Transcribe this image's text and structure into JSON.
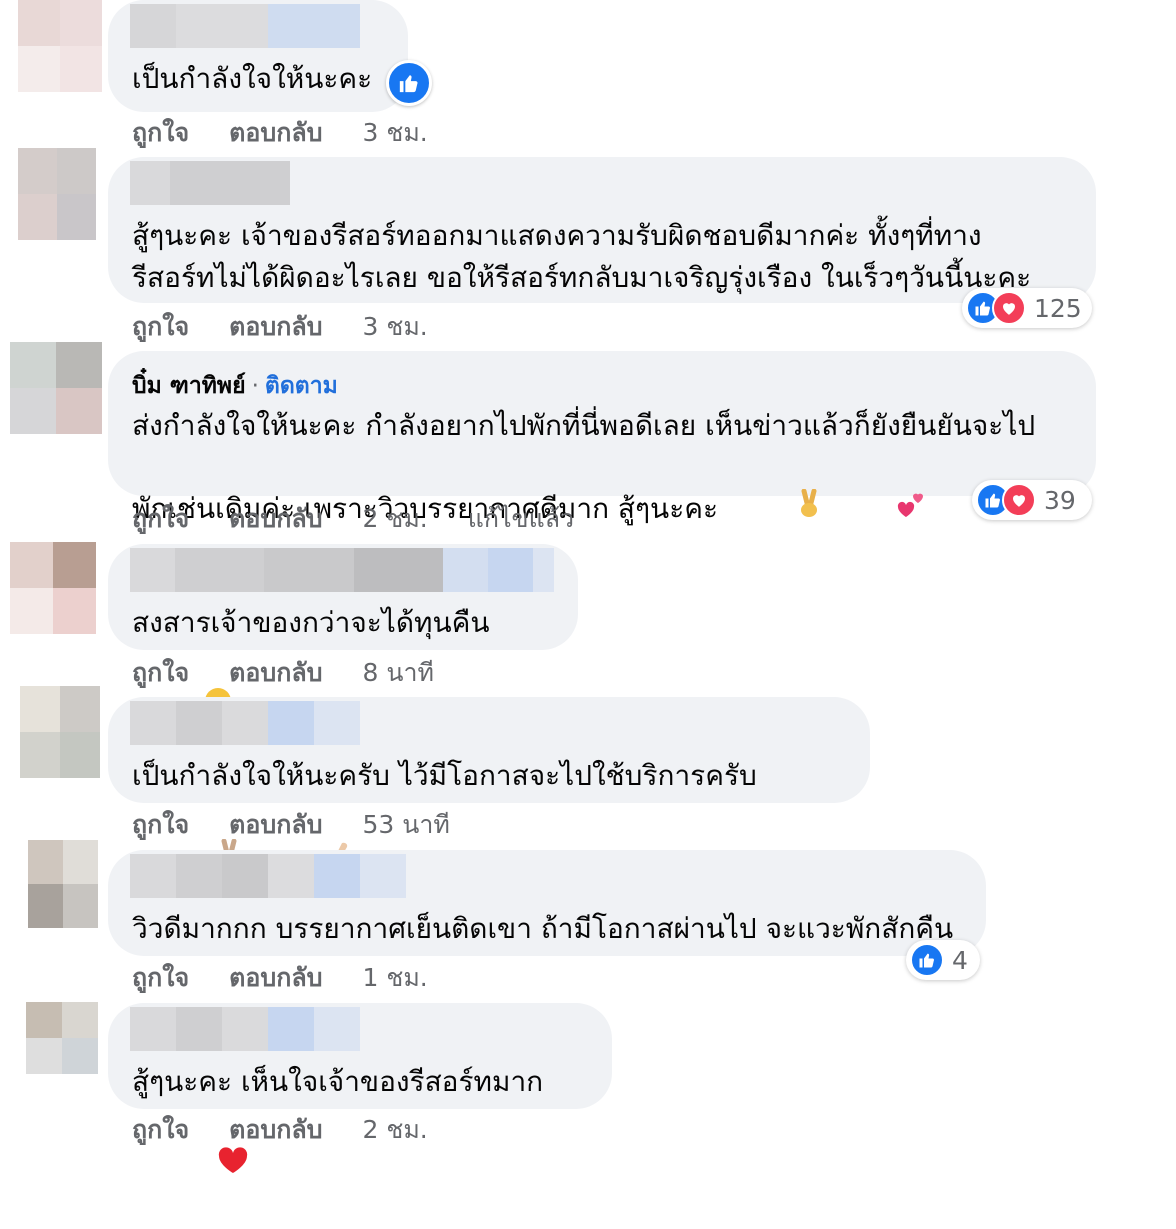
{
  "actions": {
    "like": "ถูกใจ",
    "reply": "ตอบกลับ"
  },
  "colors": {
    "bubble": "#f0f2f5",
    "like_blue": "#1877f2",
    "love_red": "#f33e58",
    "meta_gray": "#65676b",
    "follow_blue": "#216fdb"
  },
  "comments": [
    {
      "text": "เป็นกำลังใจให้นะคะ",
      "time": "3 ชม.",
      "emoji": "like-icon",
      "reactions": null
    },
    {
      "text": "สู้ๆนะคะ เจ้าของรีสอร์ทออกมาแสดงความรับผิดชอบดีมากค่ะ ทั้งๆที่ทาง\nรีสอร์ทไม่ได้ผิดอะไรเลย ขอให้รีสอร์ทกลับมาเจริญรุ่งเรือง ในเร็วๆวันนี้นะคะ",
      "time": "3 ชม.",
      "reactions": {
        "types": [
          "like",
          "love"
        ],
        "count": "125"
      }
    },
    {
      "author": "บิ๋ม ฑาทิพย์",
      "follow": "ติดตาม",
      "text": "ส่งกำลังใจให้นะคะ กำลังอยากไปพักที่นี่พอดีเลย เห็นข่าวแล้วก็ยังยืนยันจะไป\nพักเช่นเดิมค่ะ เพราะวิวบรรยากาศดีมาก สู้ๆนะคะ",
      "time": "2 ชม.",
      "edited": "แก้ไขแล้ว",
      "emoji": "victory-hand-icon, two-hearts-icon",
      "reactions": {
        "types": [
          "like",
          "love"
        ],
        "count": "39"
      }
    },
    {
      "text": "สงสารเจ้าของกว่าจะได้ทุนคืน",
      "time": "8 นาที",
      "emoji": "sad-face-icon",
      "reactions": null
    },
    {
      "text": "เป็นกำลังใจให้นะครับ ไว้มีโอกาสจะไปใช้บริการครับ",
      "time": "53 นาที",
      "emoji": "victory-hand-icon, flexed-biceps-icon",
      "reactions": null
    },
    {
      "text": "วิวดีมากกก บรรยากาศเย็นติดเขา ถ้ามีโอกาสผ่านไป จะแวะพักสักคืน",
      "time": "1 ชม.",
      "reactions": {
        "types": [
          "like"
        ],
        "count": "4"
      }
    },
    {
      "text": "สู้ๆนะคะ เห็นใจเจ้าของรีสอร์ทมาก",
      "time": "2 ชม.",
      "emoji": "red-heart-icon",
      "reactions": null
    }
  ]
}
